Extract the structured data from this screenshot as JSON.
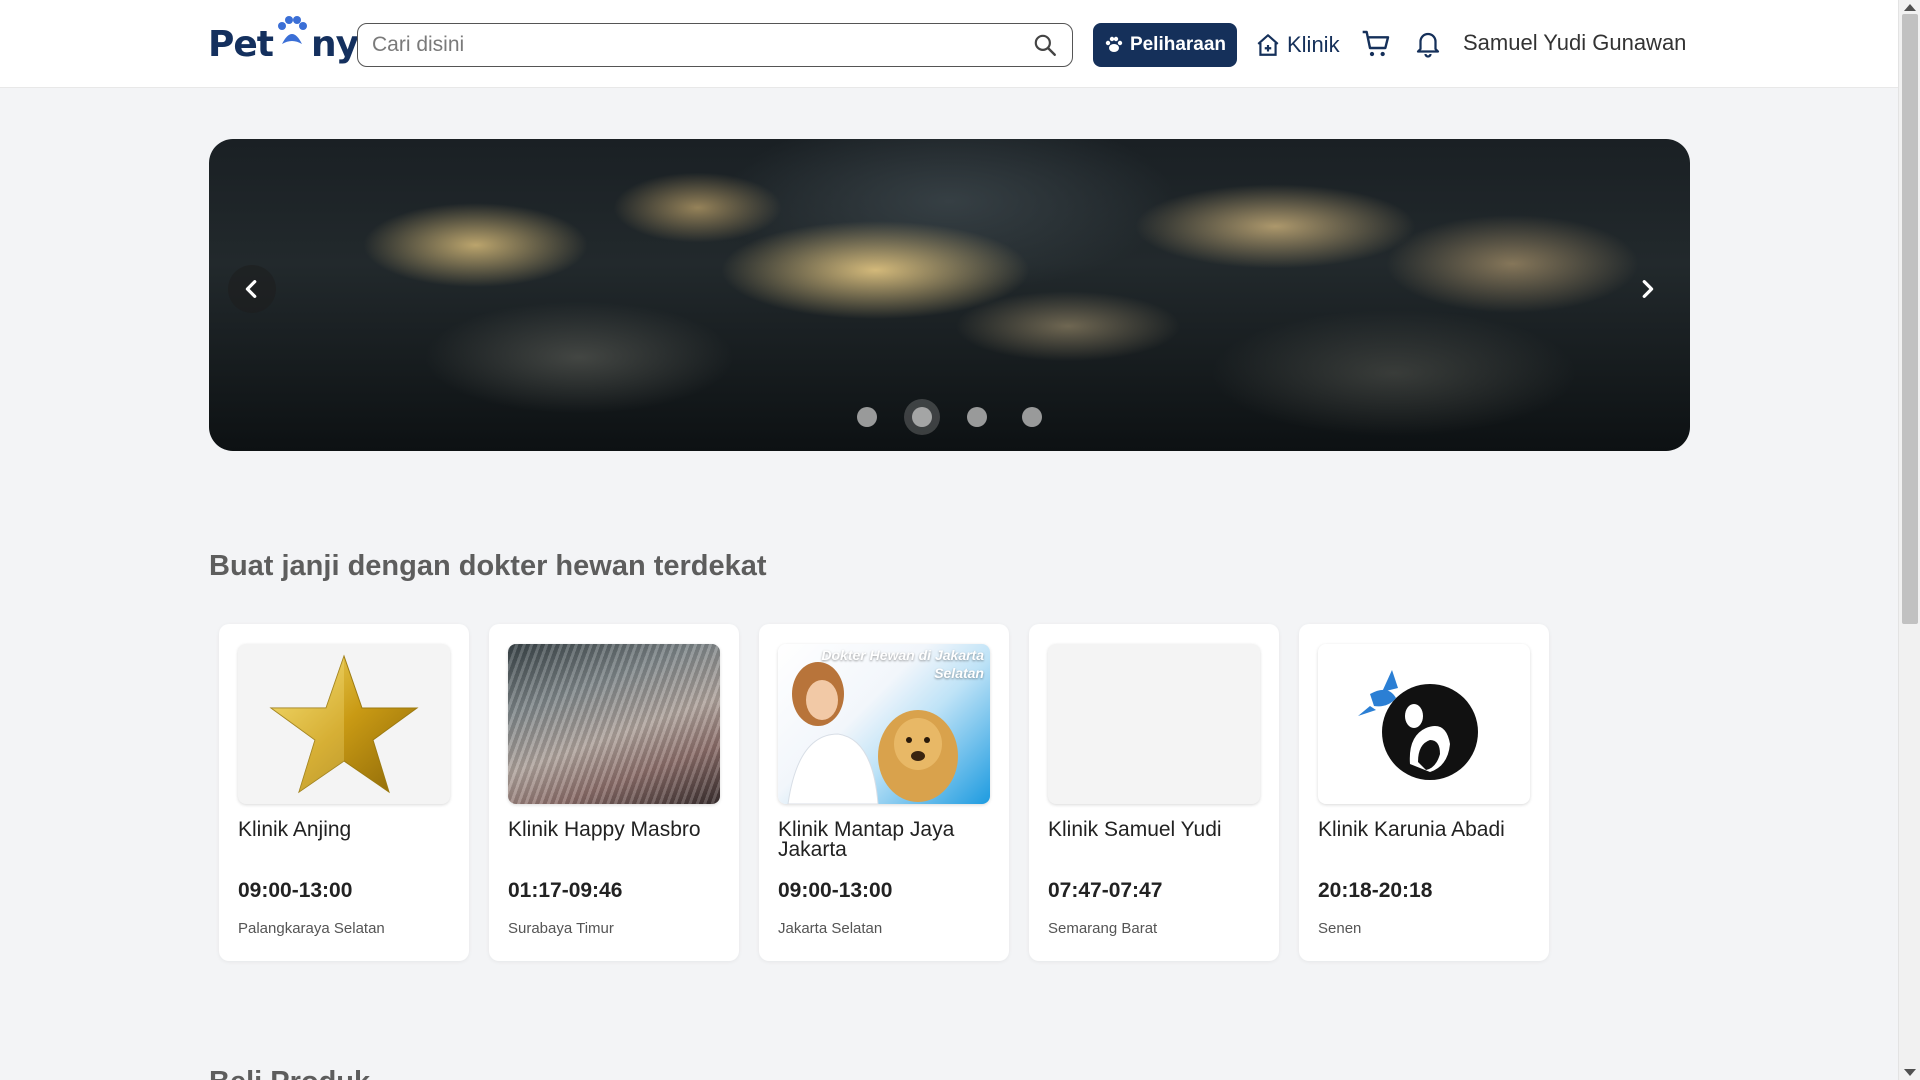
{
  "header": {
    "logo_left": "Pet",
    "logo_right": "ny",
    "search_placeholder": "Cari disini",
    "pet_button_label": "Peliharaan",
    "klinik_label": "Klinik",
    "user_name": "Samuel Yudi Gunawan"
  },
  "banner": {
    "slide_count": 4,
    "active_slide": 2
  },
  "section": {
    "title": "Buat janji dengan dokter hewan terdekat",
    "next_title": "Beli Produk"
  },
  "clinics": [
    {
      "name": "Klinik Anjing",
      "hours": "09:00-13:00",
      "location": "Palangkaraya Selatan",
      "image": "gold-star"
    },
    {
      "name": "Klinik Happy Masbro",
      "hours": "01:17-09:46",
      "location": "Surabaya Timur",
      "image": "cash-stack"
    },
    {
      "name": "Klinik Mantap Jaya Jakarta",
      "hours": "09:00-13:00",
      "location": "Jakarta Selatan",
      "image": "vet-with-dog",
      "image_caption": "Dokter Hewan di Jakarta Selatan"
    },
    {
      "name": "Klinik Samuel Yudi",
      "hours": "07:47-07:47",
      "location": "Semarang Barat",
      "image": "blank"
    },
    {
      "name": "Klinik Karunia Abadi",
      "hours": "20:18-20:18",
      "location": "Senen",
      "image": "animal-globe-logo"
    }
  ],
  "colors": {
    "primary": "#15305a",
    "background": "#f3f4f6",
    "heading": "#5d5d5d"
  }
}
